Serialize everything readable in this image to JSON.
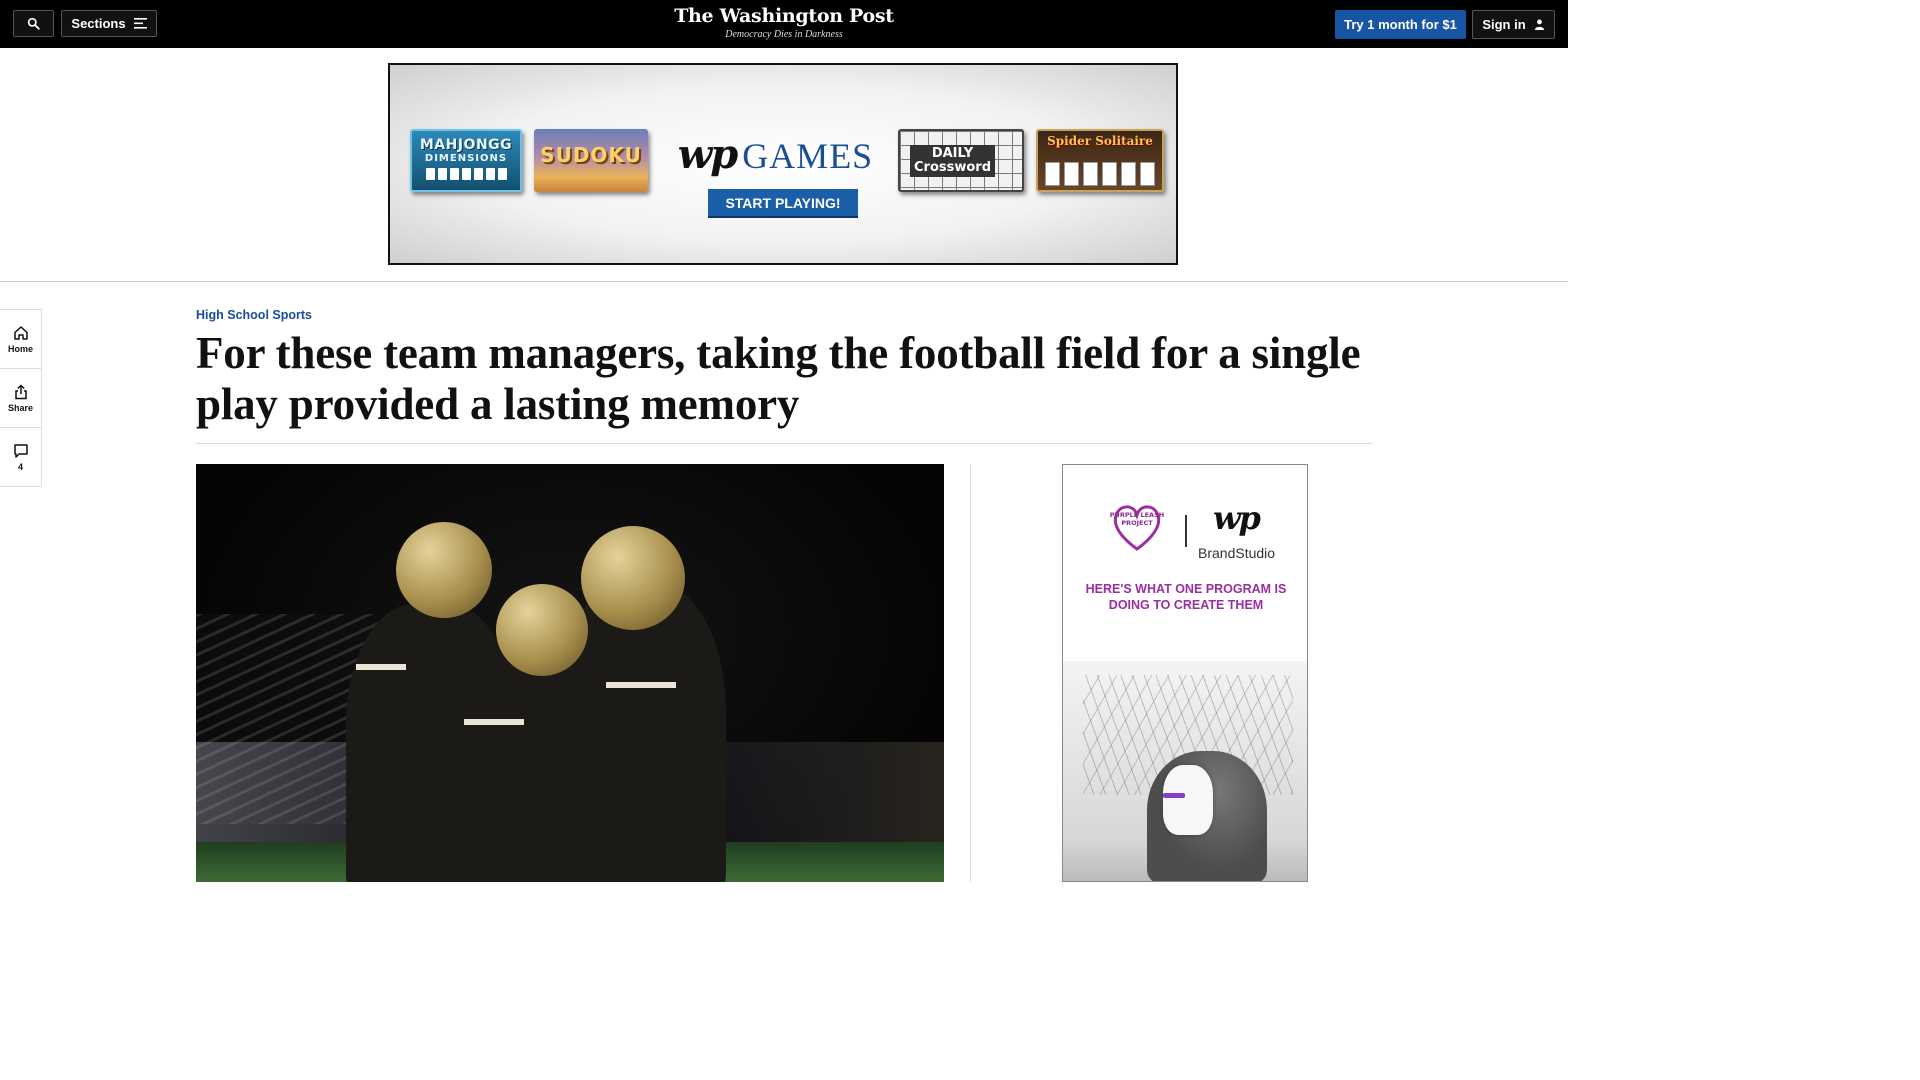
{
  "header": {
    "sections_label": "Sections",
    "logo_text": "The Washington Post",
    "tagline": "Democracy Dies in Darkness",
    "subscribe_label": "Try 1 month for $1",
    "signin_label": "Sign in"
  },
  "top_ad": {
    "mahjongg_line1": "MAHJONGG",
    "mahjongg_line2": "DIMENSIONS",
    "sudoku": "SUDOKU",
    "wp_mark": "wp",
    "games": "GAMES",
    "cta": "START PLAYING!",
    "crossword_line1": "DAILY",
    "crossword_line2": "Crossword",
    "spider": "Spider Solitaire"
  },
  "rail": {
    "home_label": "Home",
    "share_label": "Share",
    "comments_count": "4"
  },
  "article": {
    "kicker": "High School Sports",
    "headline": "For these team managers, taking the football field for a single play provided a lasting memory"
  },
  "side_ad": {
    "badge": "PURPLE LEASH PROJECT",
    "wp_mark": "wp",
    "brand": "BrandStudio",
    "message": "HERE'S WHAT ONE PROGRAM IS DOING TO CREATE THEM",
    "collar_color": "#8a3cc4"
  },
  "colors": {
    "accent_blue": "#1955a5",
    "kicker_blue": "#1a4c9c",
    "ad_purple": "#9b2fa0"
  }
}
